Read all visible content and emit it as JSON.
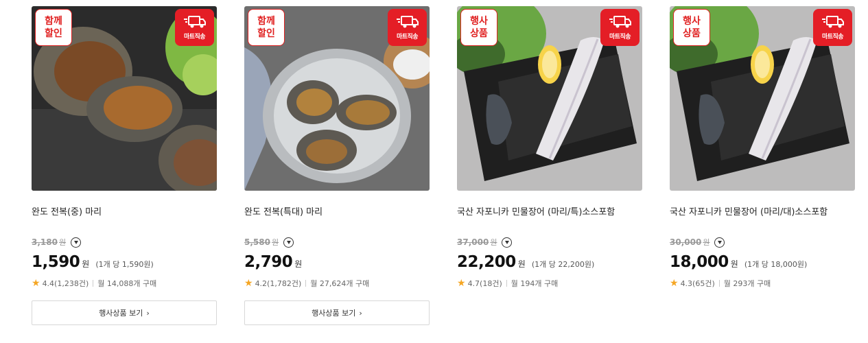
{
  "products": [
    {
      "promo_badge": "함께\n할인",
      "mart_badge": "마트직송",
      "photo_icon": "abalone-photo",
      "title": "완도 전복(중) 마리",
      "original_price": "3,180",
      "original_unit": "원",
      "price": "1,590",
      "price_unit": "원",
      "per_unit": "(1개 당 1,590원)",
      "rating": "4.4(1,238건)",
      "monthly": "월 14,088개 구매",
      "button_label": "행사상품 보기",
      "has_button": true
    },
    {
      "promo_badge": "함께\n할인",
      "mart_badge": "마트직송",
      "photo_icon": "abalone-bowl-photo",
      "title": "완도 전복(특대) 마리",
      "original_price": "5,580",
      "original_unit": "원",
      "price": "2,790",
      "price_unit": "원",
      "per_unit": "",
      "rating": "4.2(1,782건)",
      "monthly": "월 27,624개 구매",
      "button_label": "행사상품 보기",
      "has_button": true
    },
    {
      "promo_badge": "행사\n상품",
      "mart_badge": "마트직송",
      "photo_icon": "eel-photo",
      "title": "국산 자포니카 민물장어 (마리/특)소스포함",
      "original_price": "37,000",
      "original_unit": "원",
      "price": "22,200",
      "price_unit": "원",
      "per_unit": "(1개 당 22,200원)",
      "rating": "4.7(18건)",
      "monthly": "월 194개 구매",
      "button_label": "",
      "has_button": false
    },
    {
      "promo_badge": "행사\n상품",
      "mart_badge": "마트직송",
      "photo_icon": "eel-photo",
      "title": "국산 자포니카 민물장어 (마리/대)소스포함",
      "original_price": "30,000",
      "original_unit": "원",
      "price": "18,000",
      "price_unit": "원",
      "per_unit": "(1개 당 18,000원)",
      "rating": "4.3(65건)",
      "monthly": "월 293개 구매",
      "button_label": "",
      "has_button": false
    }
  ],
  "colors": {
    "accent_red": "#e41e26",
    "star": "#f5a623"
  }
}
